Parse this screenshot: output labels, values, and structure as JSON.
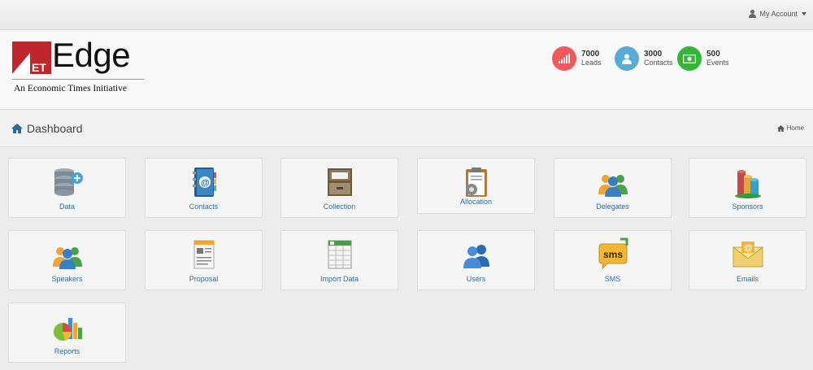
{
  "topbar": {
    "account_label": "My Account"
  },
  "logo": {
    "badge_text": "ET",
    "name": "Edge",
    "tagline": "An Economic Times Initiative"
  },
  "stats": [
    {
      "value": "7000",
      "label": "Leads",
      "icon": "signal-icon",
      "color": "#f05a5b"
    },
    {
      "value": "3000",
      "label": "Contacts",
      "icon": "user-icon",
      "color": "#5aaad8"
    },
    {
      "value": "500",
      "label": "Events",
      "icon": "money-icon",
      "color": "#35b536"
    }
  ],
  "title": {
    "text": "Dashboard",
    "icon": "home-icon"
  },
  "breadcrumb": {
    "label": "Home",
    "icon": "home-icon"
  },
  "tiles": [
    {
      "label": "Data",
      "icon": "database-icon"
    },
    {
      "label": "Contacts",
      "icon": "address-book-icon"
    },
    {
      "label": "Collection",
      "icon": "file-cabinet-icon"
    },
    {
      "label": "Allocation",
      "icon": "clipboard-gear-icon"
    },
    {
      "label": "Delegates",
      "icon": "group-icon"
    },
    {
      "label": "Sponsors",
      "icon": "coins-stack-icon"
    },
    {
      "label": "Speakers",
      "icon": "speakers-group-icon"
    },
    {
      "label": "Proposal",
      "icon": "document-icon"
    },
    {
      "label": "Import Data",
      "icon": "spreadsheet-icon"
    },
    {
      "label": "Users",
      "icon": "users-icon"
    },
    {
      "label": "SMS",
      "icon": "sms-bubble-icon"
    },
    {
      "label": "Emails",
      "icon": "envelope-icon"
    },
    {
      "label": "Reports",
      "icon": "pie-chart-icon"
    }
  ]
}
